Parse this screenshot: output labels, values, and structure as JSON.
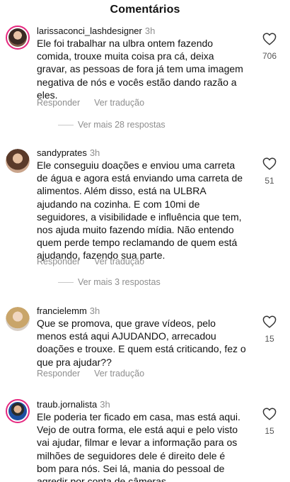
{
  "header": {
    "title": "Comentários"
  },
  "actions": {
    "reply": "Responder",
    "translate": "Ver tradução"
  },
  "comments": [
    {
      "username": "larissaconci_lashdesigner",
      "time": "3h",
      "text": "Ele foi trabalhar na ulbra ontem fazendo comida, trouxe muita coisa pra cá, deixa gravar, as pessoas de fora já tem uma imagem negativa de nós e vocês estão dando razão a eles.",
      "likes": "706",
      "view_more": "Ver mais 28 respostas"
    },
    {
      "username": "sandyprates",
      "time": "3h",
      "text": "Ele conseguiu doações e enviou uma carreta de água e agora está enviando uma carreta de alimentos. Além disso, está na ULBRA ajudando na cozinha. E com 10mi de seguidores, a visibilidade e influência que tem, nos ajuda muito fazendo mídia. Não entendo quem perde tempo reclamando de quem está ajudando, fazendo sua parte.",
      "likes": "51",
      "view_more": "Ver mais 3 respostas"
    },
    {
      "username": "francielemm",
      "time": "3h",
      "text": "Que se promova, que grave vídeos, pelo menos está aqui AJUDANDO, arrecadou doações e trouxe. E quem está criticando, fez o que pra ajudar??",
      "likes": "15"
    },
    {
      "username": "traub.jornalista",
      "time": "3h",
      "text": "Ele poderia ter ficado em casa, mas está aqui. Vejo de outra forma, ele está aqui e pelo visto vai ajudar, filmar e levar a informação para os milhões de seguidores dele é direito dele é bom para nós. Sei lá, mania do pessoal de agredir por conta de câmeras.",
      "likes": "15"
    }
  ]
}
